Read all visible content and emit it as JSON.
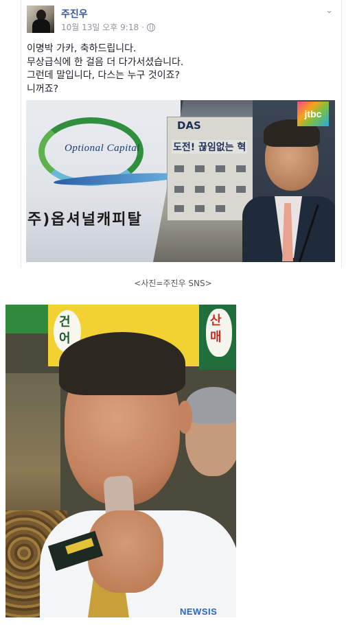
{
  "post": {
    "author": "주진우",
    "timestamp": "10월 13일 오후 9:18",
    "separator": "·",
    "privacy_icon": "globe-icon",
    "menu_icon": "chevron-down-icon",
    "lines": [
      "이명박 가카, 축하드립니다.",
      "무상급식에 한 걸음 더 다가서셨습니다.",
      "그런데 말입니다, 다스는 누구 것이죠?",
      "니꺼죠?"
    ]
  },
  "photo1": {
    "logo_text": "Optional Capital",
    "company_name": "주)옵셔널캐피탈",
    "das_sign": "DAS",
    "das_slogan": "도전! 끊임없는 혁",
    "broadcaster": "jtbc"
  },
  "caption": "<사진=주진우 SNS>",
  "photo2": {
    "sign_left": "건어",
    "sign_right": "산매",
    "watermark": "NEWSIS"
  },
  "colors": {
    "name_link": "#365899",
    "meta_gray": "#90949c",
    "text": "#1d2129"
  }
}
